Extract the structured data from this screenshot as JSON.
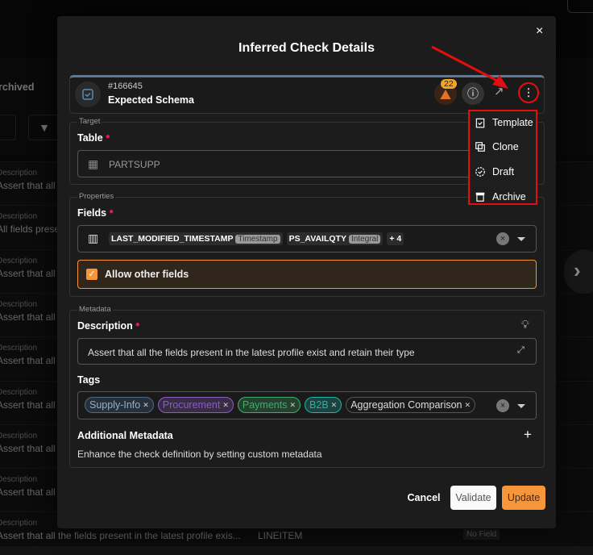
{
  "background": {
    "archived_label": "rchived",
    "rows": [
      {
        "label": "Description",
        "text": "Assert that all t"
      },
      {
        "label": "Description",
        "text": "All fields presen"
      },
      {
        "label": "Description",
        "text": "Assert that all t"
      },
      {
        "label": "Description",
        "text": "Assert that all t"
      },
      {
        "label": "Description",
        "text": "Assert that all t"
      },
      {
        "label": "Description",
        "text": "Assert that all t"
      },
      {
        "label": "Description",
        "text": "Assert that all t"
      },
      {
        "label": "Description",
        "text": "Assert that all t"
      },
      {
        "label": "Description",
        "text": "Assert that all the fields present in the latest profile exis...",
        "table": "LINEITEM",
        "field": "No Field"
      }
    ]
  },
  "modal": {
    "title": "Inferred Check Details",
    "close": "×",
    "check": {
      "id": "#166645",
      "name": "Expected Schema",
      "anomaly_count": "22"
    },
    "menu": [
      "Template",
      "Clone",
      "Draft",
      "Archive"
    ],
    "target": {
      "legend": "Target",
      "table_label": "Table",
      "table_value": "PARTSUPP"
    },
    "properties": {
      "legend": "Properties",
      "fields_label": "Fields",
      "fields": [
        {
          "name": "LAST_MODIFIED_TIMESTAMP",
          "type": "Timestamp"
        },
        {
          "name": "PS_AVAILQTY",
          "type": "Integral"
        }
      ],
      "more": "+ 4",
      "allow_other": "Allow other fields",
      "allow_other_checked": true
    },
    "metadata": {
      "legend": "Metadata",
      "description_label": "Description",
      "description": "Assert that all the fields present in the latest profile exist and retain their type",
      "tags_label": "Tags",
      "tags": [
        {
          "name": "Supply-Info",
          "color": "#4a6b8a"
        },
        {
          "name": "Procurement",
          "color": "#8b5cc4"
        },
        {
          "name": "Payments",
          "color": "#3fae6a"
        },
        {
          "name": "B2B",
          "color": "#1fb5a8"
        },
        {
          "name": "Aggregation Comparison",
          "color": "#555555"
        }
      ],
      "additional_label": "Additional Metadata",
      "additional_hint": "Enhance the check definition by setting custom metadata"
    },
    "buttons": {
      "cancel": "Cancel",
      "validate": "Validate",
      "update": "Update"
    }
  },
  "colors": {
    "accent": "#f7953a",
    "highlight": "#e01010"
  }
}
